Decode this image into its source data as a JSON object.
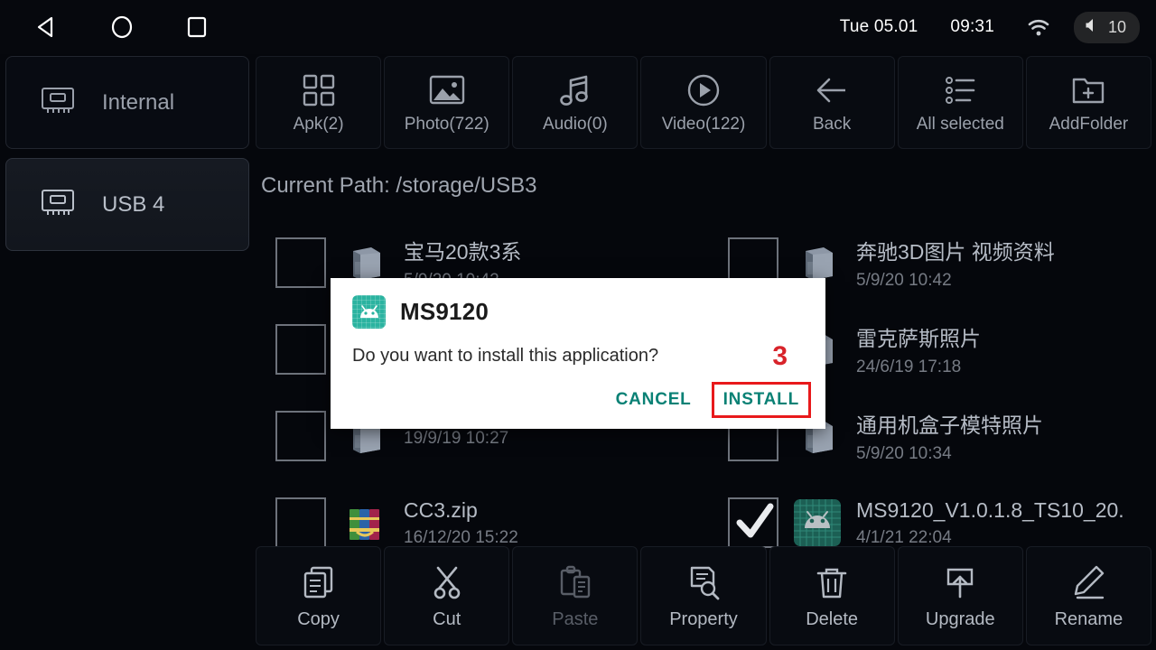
{
  "statusbar": {
    "nav": [
      {
        "name": "back-nav-icon",
        "label": "back"
      },
      {
        "name": "home-nav-icon",
        "label": "home"
      },
      {
        "name": "recents-nav-icon",
        "label": "recents"
      }
    ],
    "date": "Tue 05.01",
    "time": "09:31",
    "wifi_icon": "wifi-icon",
    "volume_icon": "volume-icon",
    "volume_level": "10"
  },
  "sidebar": {
    "items": [
      {
        "label": "Internal",
        "icon": "storage-chip-icon",
        "active": false
      },
      {
        "label": "USB 4",
        "icon": "storage-chip-icon",
        "active": true
      }
    ]
  },
  "top_toolbar": {
    "buttons": [
      {
        "label": "Apk(2)",
        "icon": "grid-apps-icon",
        "disabled": false
      },
      {
        "label": "Photo(722)",
        "icon": "image-icon",
        "disabled": false
      },
      {
        "label": "Audio(0)",
        "icon": "music-note-icon",
        "disabled": false
      },
      {
        "label": "Video(122)",
        "icon": "play-circle-icon",
        "disabled": false
      },
      {
        "label": "Back",
        "icon": "arrow-left-icon",
        "disabled": false
      },
      {
        "label": "All selected",
        "icon": "list-bullet-icon",
        "disabled": false
      },
      {
        "label": "AddFolder",
        "icon": "folder-plus-icon",
        "disabled": false
      }
    ]
  },
  "path": {
    "label": "Current Path: /storage/USB3"
  },
  "files": [
    {
      "name": "宝马20款3系",
      "date": "5/9/20 10:42",
      "icon": "folder-icon",
      "checked": false
    },
    {
      "name": "奔驰3D图片 视频资料",
      "date": "5/9/20 10:42",
      "icon": "folder-icon",
      "checked": false
    },
    {
      "name": "",
      "date": "",
      "icon": "folder-icon",
      "checked": false
    },
    {
      "name": "雷克萨斯照片",
      "date": "24/6/19 17:18",
      "icon": "folder-icon",
      "checked": false
    },
    {
      "name": "",
      "date": "19/9/19 10:27",
      "icon": "folder-icon",
      "checked": false
    },
    {
      "name": "通用机盒子模特照片",
      "date": "5/9/20 10:34",
      "icon": "folder-icon",
      "checked": false
    },
    {
      "name": "CC3.zip",
      "date": "16/12/20 15:22",
      "icon": "zip-archive-icon",
      "checked": false
    },
    {
      "name": "MS9120_V1.0.1.8_TS10_20.",
      "date": "4/1/21 22:04",
      "icon": "apk-android-icon",
      "checked": true
    }
  ],
  "bottom_toolbar": {
    "buttons": [
      {
        "label": "Copy",
        "icon": "copy-icon",
        "disabled": false
      },
      {
        "label": "Cut",
        "icon": "scissors-icon",
        "disabled": false
      },
      {
        "label": "Paste",
        "icon": "clipboard-paste-icon",
        "disabled": true
      },
      {
        "label": "Property",
        "icon": "document-search-icon",
        "disabled": false
      },
      {
        "label": "Delete",
        "icon": "trash-icon",
        "disabled": false
      },
      {
        "label": "Upgrade",
        "icon": "upload-box-icon",
        "disabled": false
      },
      {
        "label": "Rename",
        "icon": "pencil-icon",
        "disabled": false
      }
    ]
  },
  "dialog": {
    "app_icon": "android-app-icon",
    "title": "MS9120",
    "message": "Do you want to install this application?",
    "cancel_label": "CANCEL",
    "install_label": "INSTALL",
    "annotation_number": "3",
    "accent_color": "#0a8175",
    "highlight_color": "#e8191b"
  }
}
